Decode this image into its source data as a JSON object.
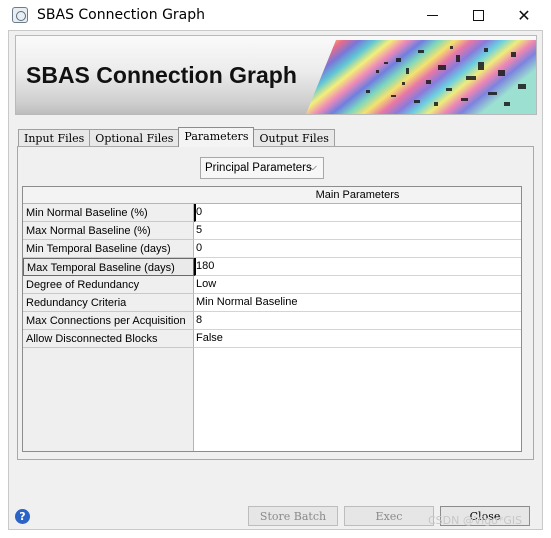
{
  "window": {
    "title": "SBAS Connection Graph",
    "minimize_symbol": "—",
    "close_symbol": "✕"
  },
  "banner": {
    "title": "SBAS Connection Graph"
  },
  "tabs": [
    {
      "label": "Input Files",
      "active": false
    },
    {
      "label": "Optional Files",
      "active": false
    },
    {
      "label": "Parameters",
      "active": true
    },
    {
      "label": "Output Files",
      "active": false
    }
  ],
  "parameters": {
    "combo_selected": "Principal Parameters",
    "column_header": "Main Parameters",
    "rows": [
      {
        "label": "Min Normal Baseline (%)",
        "value": "0"
      },
      {
        "label": "Max Normal Baseline (%)",
        "value": "5"
      },
      {
        "label": "Min Temporal Baseline (days)",
        "value": "0"
      },
      {
        "label": "Max Temporal Baseline (days)",
        "value": "180"
      },
      {
        "label": "Degree of Redundancy",
        "value": "Low"
      },
      {
        "label": "Redundancy Criteria",
        "value": "Min Normal Baseline"
      },
      {
        "label": "Max Connections per Acquisition",
        "value": "8"
      },
      {
        "label": "Allow Disconnected Blocks",
        "value": "False"
      }
    ]
  },
  "buttons": {
    "help": "?",
    "store_batch": "Store Batch",
    "exec": "Exec",
    "close": "Close"
  },
  "watermark": "CSDN @Vigo*GIS",
  "colors": {
    "help_icon": "#2b63c6",
    "dialog_bg": "#f0f0f0"
  }
}
